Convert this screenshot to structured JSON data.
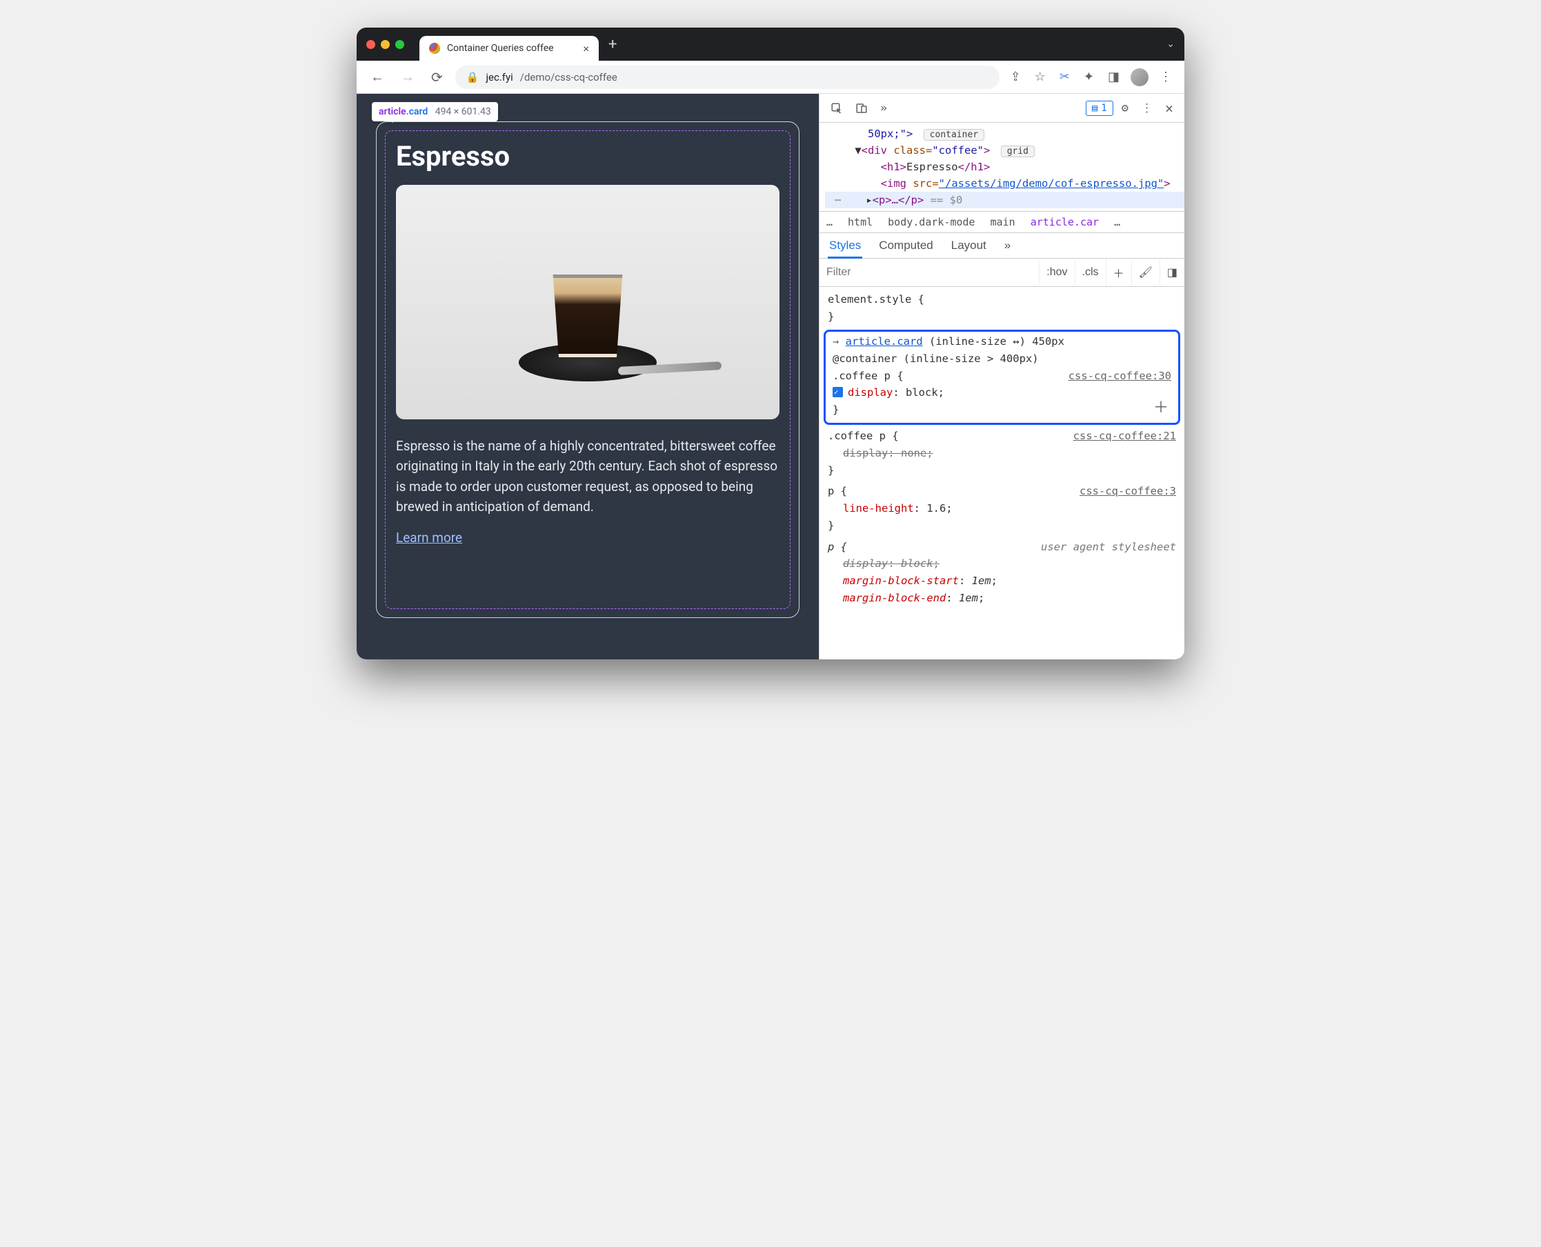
{
  "browser": {
    "tab_title": "Container Queries coffee",
    "url_prefix": "jec.fyi",
    "url_path": "/demo/css-cq-coffee"
  },
  "tooltip": {
    "selector_el": "article",
    "selector_cls": ".card",
    "dimensions": "494 × 601.43"
  },
  "card": {
    "heading": "Espresso",
    "paragraph": "Espresso is the name of a highly concentrated, bittersweet coffee originating in Italy in the early 20th century. Each shot of espresso is made to order upon customer request, as opposed to being brewed in anticipation of demand.",
    "link_text": "Learn more"
  },
  "devtools": {
    "issues_count": "1",
    "dom": {
      "line0_suffix_style": "50px;\">",
      "line0_badge": "container",
      "line1_tag_open": "<div ",
      "line1_attr": "class=",
      "line1_val": "\"coffee\"",
      "line1_tag_close": ">",
      "line1_badge": "grid",
      "h1_open": "<h1>",
      "h1_text": "Espresso",
      "h1_close": "</h1>",
      "img_open": "<img ",
      "img_attr": "src=",
      "img_href": "\"/assets/img/demo/cof-espresso.jpg\"",
      "img_close": ">",
      "p_line": "<p>…</p>",
      "p_eq": " == $0"
    },
    "breadcrumbs": [
      "…",
      "html",
      "body.dark-mode",
      "main",
      "article.car",
      "…"
    ],
    "styles_tabs": [
      "Styles",
      "Computed",
      "Layout"
    ],
    "filter_placeholder": "Filter",
    "toolbar_chips": [
      ":hov",
      ".cls"
    ],
    "element_style": "element.style {",
    "rules": {
      "highlighted": {
        "arrow_sel": "article.card",
        "container_dim": "(inline-size ↔) 450px",
        "at_rule": "@container (inline-size > 400px)",
        "selector": ".coffee p {",
        "source": "css-cq-coffee:30",
        "prop_name": "display",
        "prop_value": "block"
      },
      "r2": {
        "selector": ".coffee p {",
        "source": "css-cq-coffee:21",
        "prop_name": "display",
        "prop_value": "none"
      },
      "r3": {
        "selector": "p {",
        "source": "css-cq-coffee:3",
        "prop_name": "line-height",
        "prop_value": "1.6"
      },
      "r4": {
        "selector": "p {",
        "source": "user agent stylesheet",
        "p1_name": "display",
        "p1_value": "block",
        "p2_name": "margin-block-start",
        "p2_value": "1em",
        "p3_name": "margin-block-end",
        "p3_value": "1em"
      }
    }
  }
}
